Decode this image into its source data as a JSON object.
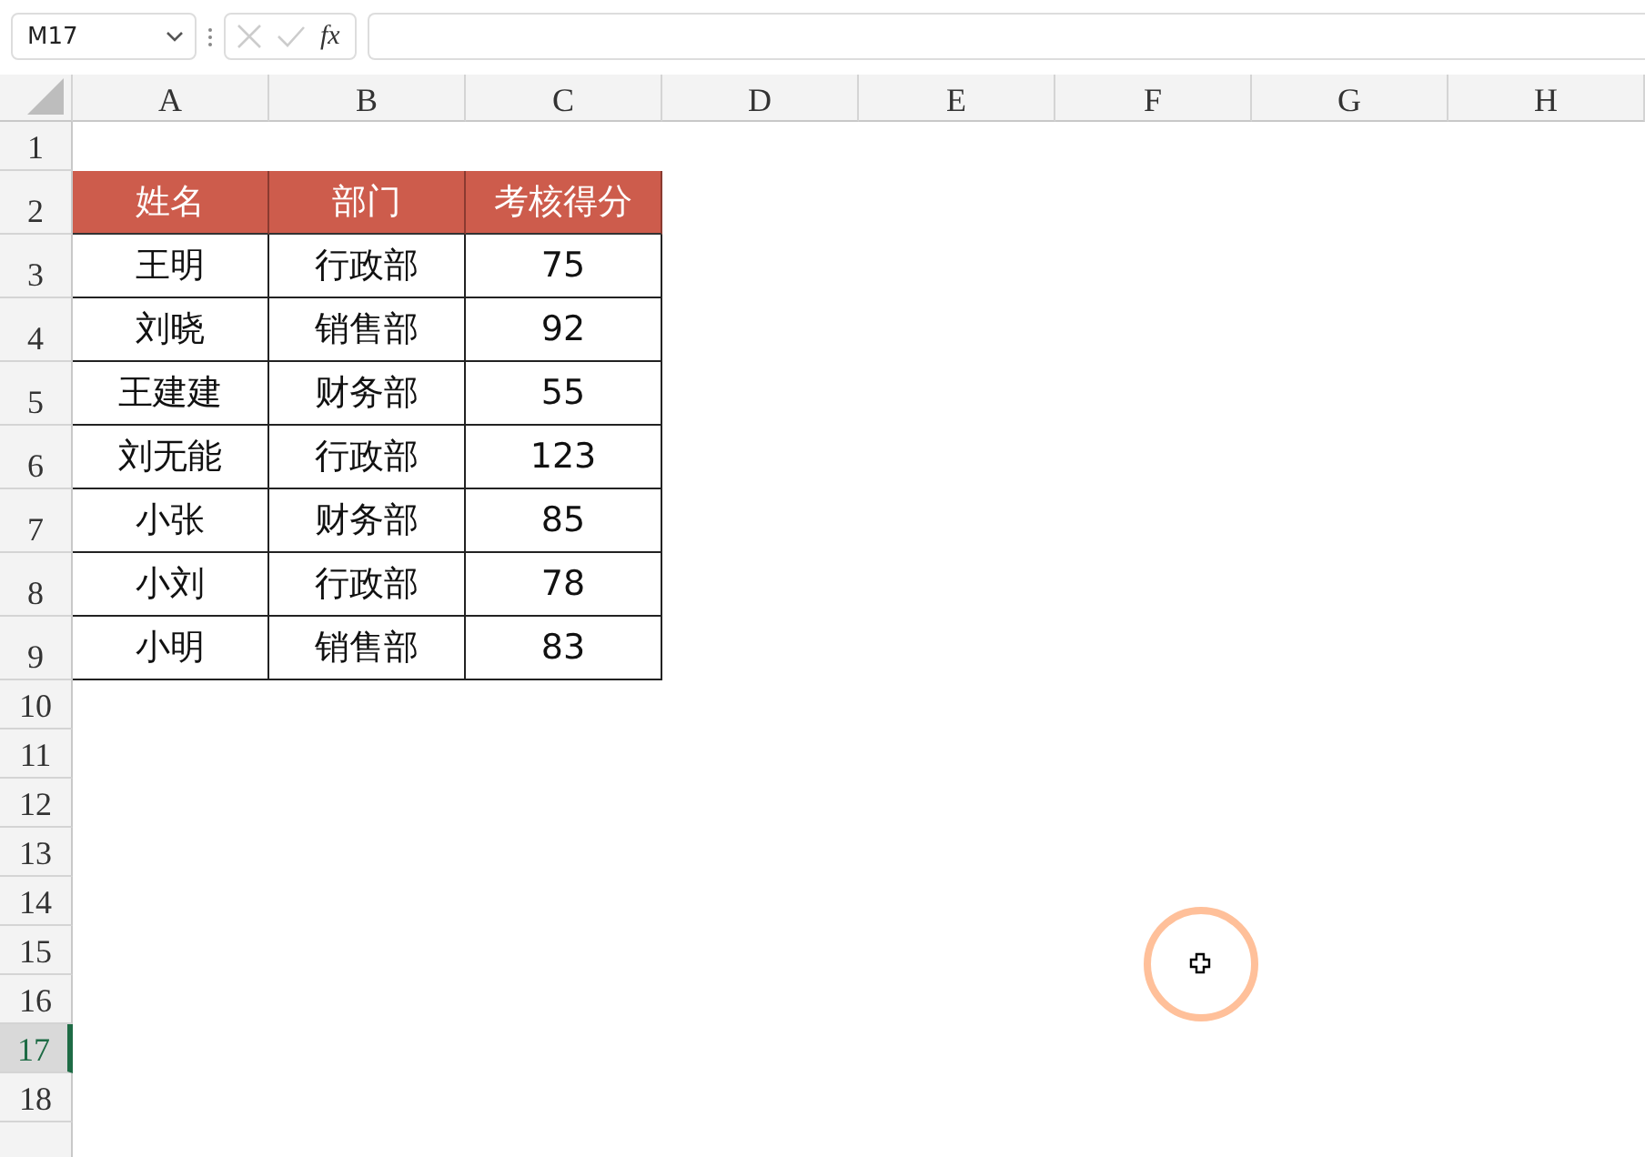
{
  "formula_bar": {
    "name_box": "M17",
    "fx_label": "fx"
  },
  "sheet": {
    "column_headers": [
      "A",
      "B",
      "C",
      "D",
      "E",
      "F",
      "G",
      "H"
    ],
    "row_headers": [
      {
        "label": "1",
        "selected": false
      },
      {
        "label": "2",
        "selected": false
      },
      {
        "label": "3",
        "selected": false
      },
      {
        "label": "4",
        "selected": false
      },
      {
        "label": "5",
        "selected": false
      },
      {
        "label": "6",
        "selected": false
      },
      {
        "label": "7",
        "selected": false
      },
      {
        "label": "8",
        "selected": false
      },
      {
        "label": "9",
        "selected": false
      },
      {
        "label": "10",
        "selected": false
      },
      {
        "label": "11",
        "selected": false
      },
      {
        "label": "12",
        "selected": false
      },
      {
        "label": "13",
        "selected": false
      },
      {
        "label": "14",
        "selected": false
      },
      {
        "label": "15",
        "selected": false
      },
      {
        "label": "16",
        "selected": false
      },
      {
        "label": "17",
        "selected": true
      },
      {
        "label": "18",
        "selected": false
      }
    ]
  },
  "table": {
    "columns": [
      "姓名",
      "部门",
      "考核得分"
    ],
    "rows": [
      [
        "王明",
        "行政部",
        "75"
      ],
      [
        "刘晓",
        "销售部",
        "92"
      ],
      [
        "王建建",
        "财务部",
        "55"
      ],
      [
        "刘无能",
        "行政部",
        "123"
      ],
      [
        "小张",
        "财务部",
        "85"
      ],
      [
        "小刘",
        "行政部",
        "78"
      ],
      [
        "小明",
        "销售部",
        "83"
      ]
    ]
  }
}
